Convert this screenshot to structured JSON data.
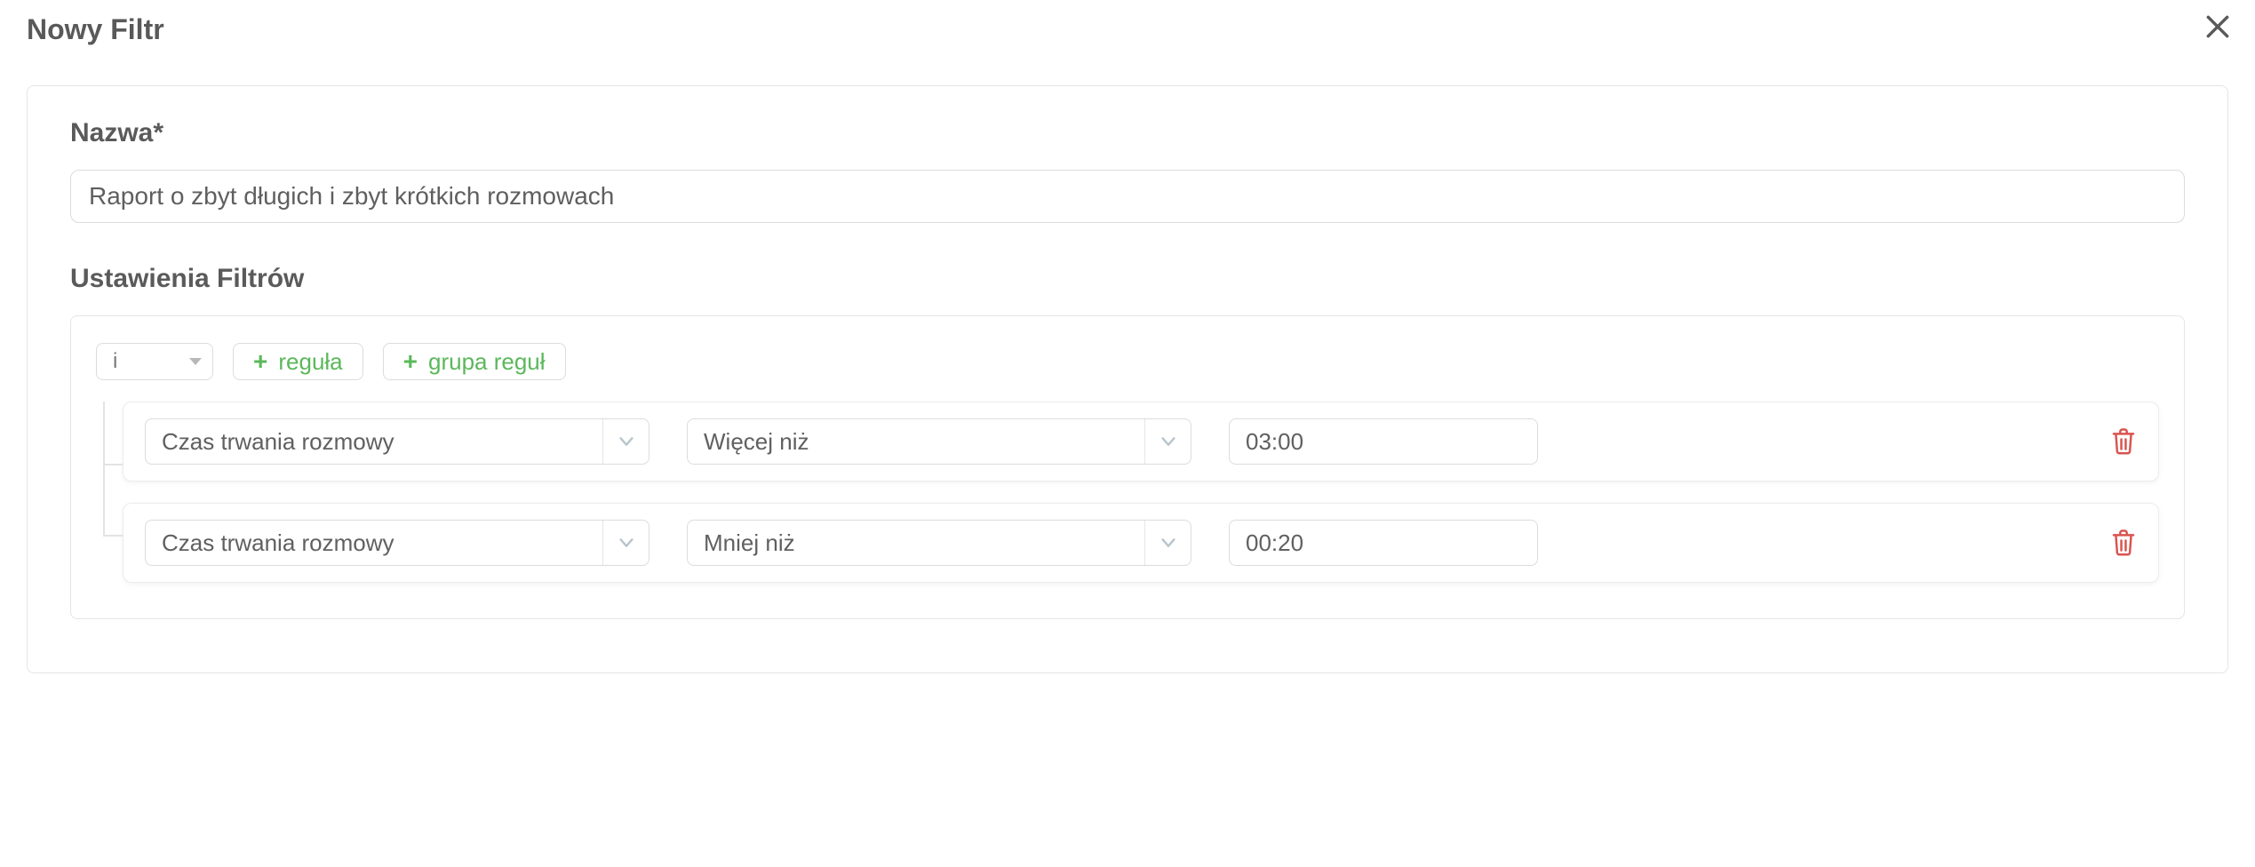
{
  "dialog": {
    "title": "Nowy Filtr"
  },
  "form": {
    "name_label": "Nazwa*",
    "name_value": "Raport o zbyt długich i zbyt krótkich rozmowach"
  },
  "filters": {
    "section_label": "Ustawienia Filtrów",
    "conjunction": "i",
    "add_rule_label": "reguła",
    "add_group_label": "grupa reguł",
    "rules": [
      {
        "field": "Czas trwania rozmowy",
        "operator": "Więcej niż",
        "value": "03:00"
      },
      {
        "field": "Czas trwania rozmowy",
        "operator": "Mniej niż",
        "value": "00:20"
      }
    ]
  },
  "colors": {
    "accent_green": "#5bb85b",
    "danger_red": "#d9534f",
    "border": "#dcdcdc"
  }
}
